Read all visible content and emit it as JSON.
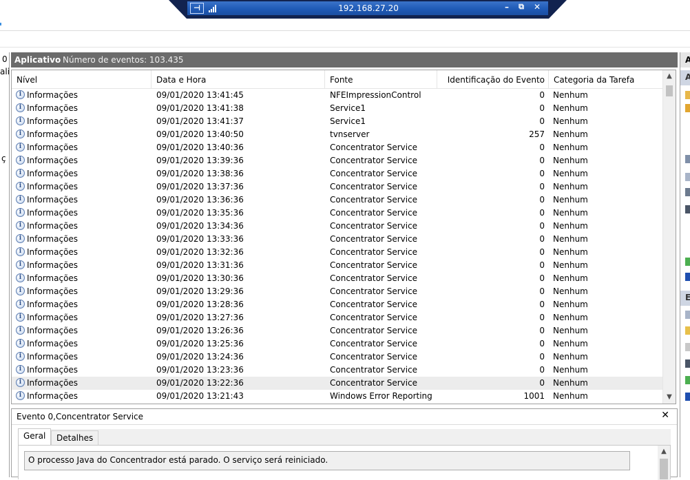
{
  "rdp": {
    "title": "192.168.27.20",
    "pin": "⊣",
    "minimize": "–",
    "restore": "⧉",
    "close": "✕"
  },
  "left_pane": {
    "frags": [
      "0",
      "ali",
      "ç"
    ]
  },
  "main": {
    "title": "Aplicativo",
    "count": "Número de eventos: 103.435"
  },
  "columns": {
    "level": "Nível",
    "date": "Data e Hora",
    "source": "Fonte",
    "id": "Identificação do Evento",
    "category": "Categoria da Tarefa"
  },
  "events": [
    {
      "level": "Informações",
      "date": "09/01/2020 13:41:45",
      "source": "NFEImpressionControl",
      "id": "0",
      "category": "Nenhum"
    },
    {
      "level": "Informações",
      "date": "09/01/2020 13:41:38",
      "source": "Service1",
      "id": "0",
      "category": "Nenhum"
    },
    {
      "level": "Informações",
      "date": "09/01/2020 13:41:37",
      "source": "Service1",
      "id": "0",
      "category": "Nenhum"
    },
    {
      "level": "Informações",
      "date": "09/01/2020 13:40:50",
      "source": "tvnserver",
      "id": "257",
      "category": "Nenhum"
    },
    {
      "level": "Informações",
      "date": "09/01/2020 13:40:36",
      "source": "Concentrator Service",
      "id": "0",
      "category": "Nenhum"
    },
    {
      "level": "Informações",
      "date": "09/01/2020 13:39:36",
      "source": "Concentrator Service",
      "id": "0",
      "category": "Nenhum"
    },
    {
      "level": "Informações",
      "date": "09/01/2020 13:38:36",
      "source": "Concentrator Service",
      "id": "0",
      "category": "Nenhum"
    },
    {
      "level": "Informações",
      "date": "09/01/2020 13:37:36",
      "source": "Concentrator Service",
      "id": "0",
      "category": "Nenhum"
    },
    {
      "level": "Informações",
      "date": "09/01/2020 13:36:36",
      "source": "Concentrator Service",
      "id": "0",
      "category": "Nenhum"
    },
    {
      "level": "Informações",
      "date": "09/01/2020 13:35:36",
      "source": "Concentrator Service",
      "id": "0",
      "category": "Nenhum"
    },
    {
      "level": "Informações",
      "date": "09/01/2020 13:34:36",
      "source": "Concentrator Service",
      "id": "0",
      "category": "Nenhum"
    },
    {
      "level": "Informações",
      "date": "09/01/2020 13:33:36",
      "source": "Concentrator Service",
      "id": "0",
      "category": "Nenhum"
    },
    {
      "level": "Informações",
      "date": "09/01/2020 13:32:36",
      "source": "Concentrator Service",
      "id": "0",
      "category": "Nenhum"
    },
    {
      "level": "Informações",
      "date": "09/01/2020 13:31:36",
      "source": "Concentrator Service",
      "id": "0",
      "category": "Nenhum"
    },
    {
      "level": "Informações",
      "date": "09/01/2020 13:30:36",
      "source": "Concentrator Service",
      "id": "0",
      "category": "Nenhum"
    },
    {
      "level": "Informações",
      "date": "09/01/2020 13:29:36",
      "source": "Concentrator Service",
      "id": "0",
      "category": "Nenhum"
    },
    {
      "level": "Informações",
      "date": "09/01/2020 13:28:36",
      "source": "Concentrator Service",
      "id": "0",
      "category": "Nenhum"
    },
    {
      "level": "Informações",
      "date": "09/01/2020 13:27:36",
      "source": "Concentrator Service",
      "id": "0",
      "category": "Nenhum"
    },
    {
      "level": "Informações",
      "date": "09/01/2020 13:26:36",
      "source": "Concentrator Service",
      "id": "0",
      "category": "Nenhum"
    },
    {
      "level": "Informações",
      "date": "09/01/2020 13:25:36",
      "source": "Concentrator Service",
      "id": "0",
      "category": "Nenhum"
    },
    {
      "level": "Informações",
      "date": "09/01/2020 13:24:36",
      "source": "Concentrator Service",
      "id": "0",
      "category": "Nenhum"
    },
    {
      "level": "Informações",
      "date": "09/01/2020 13:23:36",
      "source": "Concentrator Service",
      "id": "0",
      "category": "Nenhum"
    },
    {
      "level": "Informações",
      "date": "09/01/2020 13:22:36",
      "source": "Concentrator Service",
      "id": "0",
      "category": "Nenhum",
      "selected": true
    },
    {
      "level": "Informações",
      "date": "09/01/2020 13:21:43",
      "source": "Windows Error Reporting",
      "id": "1001",
      "category": "Nenhum"
    }
  ],
  "details": {
    "title": "Evento 0,Concentrator Service",
    "close": "✕",
    "tabs": [
      "Geral",
      "Detalhes"
    ],
    "message": "O processo Java do Concentrador está parado. O serviço será reiniciado."
  },
  "right_pane": {
    "head1": "A",
    "head2": "A",
    "head3": "E"
  },
  "colors": {
    "rdp_bar": "#12234f",
    "header_gray": "#6b6b6b",
    "selected_row": "#ececec"
  }
}
